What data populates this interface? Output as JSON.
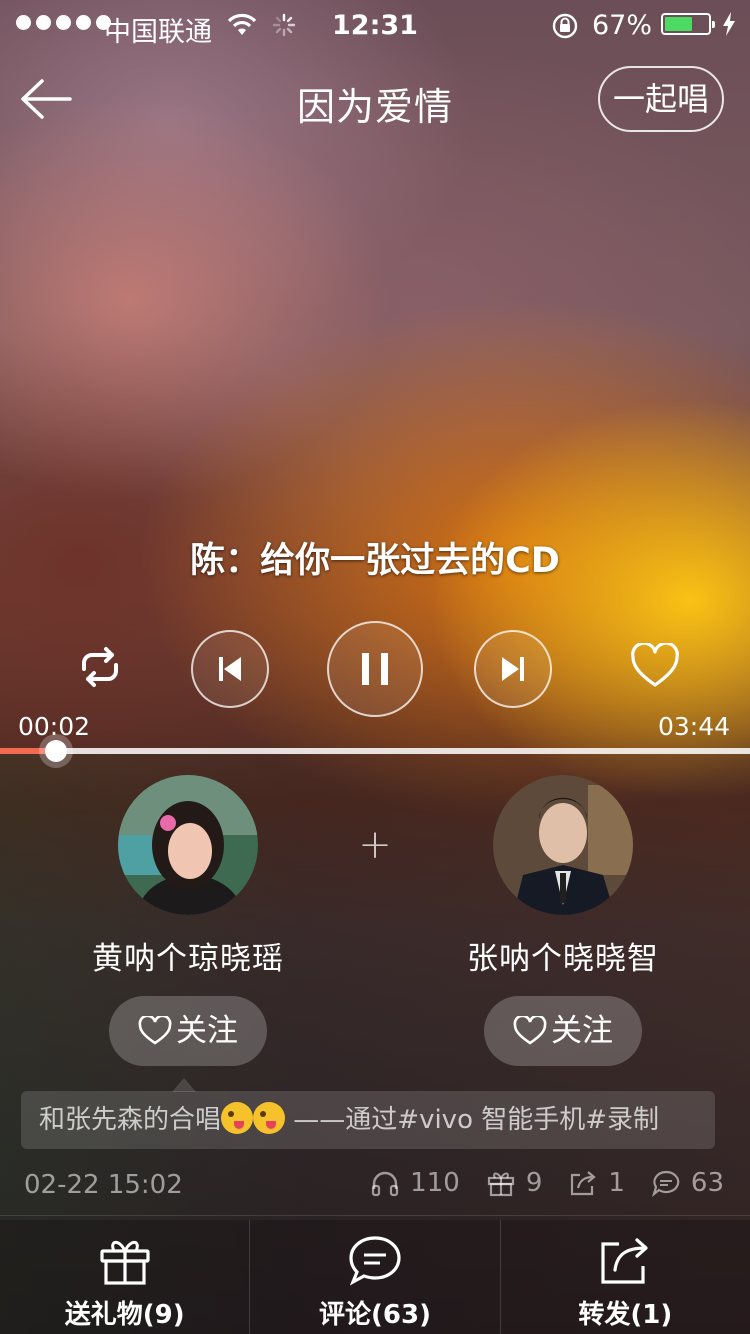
{
  "status_bar": {
    "carrier": "中国联通",
    "time": "12:31",
    "battery_percent": "67%",
    "battery_level": 0.67,
    "signal_bars": 5
  },
  "header": {
    "title": "因为爱情",
    "duet_button": "一起唱"
  },
  "player": {
    "lyric": "陈：给你一张过去的CD",
    "current_time": "00:02",
    "total_time": "03:44",
    "progress": 0.075,
    "accent_color": "#f26a4f"
  },
  "singers": [
    {
      "name": "黄呐个琼晓瑶",
      "follow_label": "关注"
    },
    {
      "name": "张呐个晓晓智",
      "follow_label": "关注"
    }
  ],
  "separator": "+",
  "caption": {
    "before_emoji": "和张先森的合唱",
    "after_emoji": " ——通过#vivo 智能手机#录制"
  },
  "meta": {
    "date": "02-22 15:02",
    "listens": "110",
    "gifts": "9",
    "shares": "1",
    "comments": "63"
  },
  "tabbar": {
    "gift": "送礼物(9)",
    "comment": "评论(63)",
    "share": "转发(1)"
  }
}
